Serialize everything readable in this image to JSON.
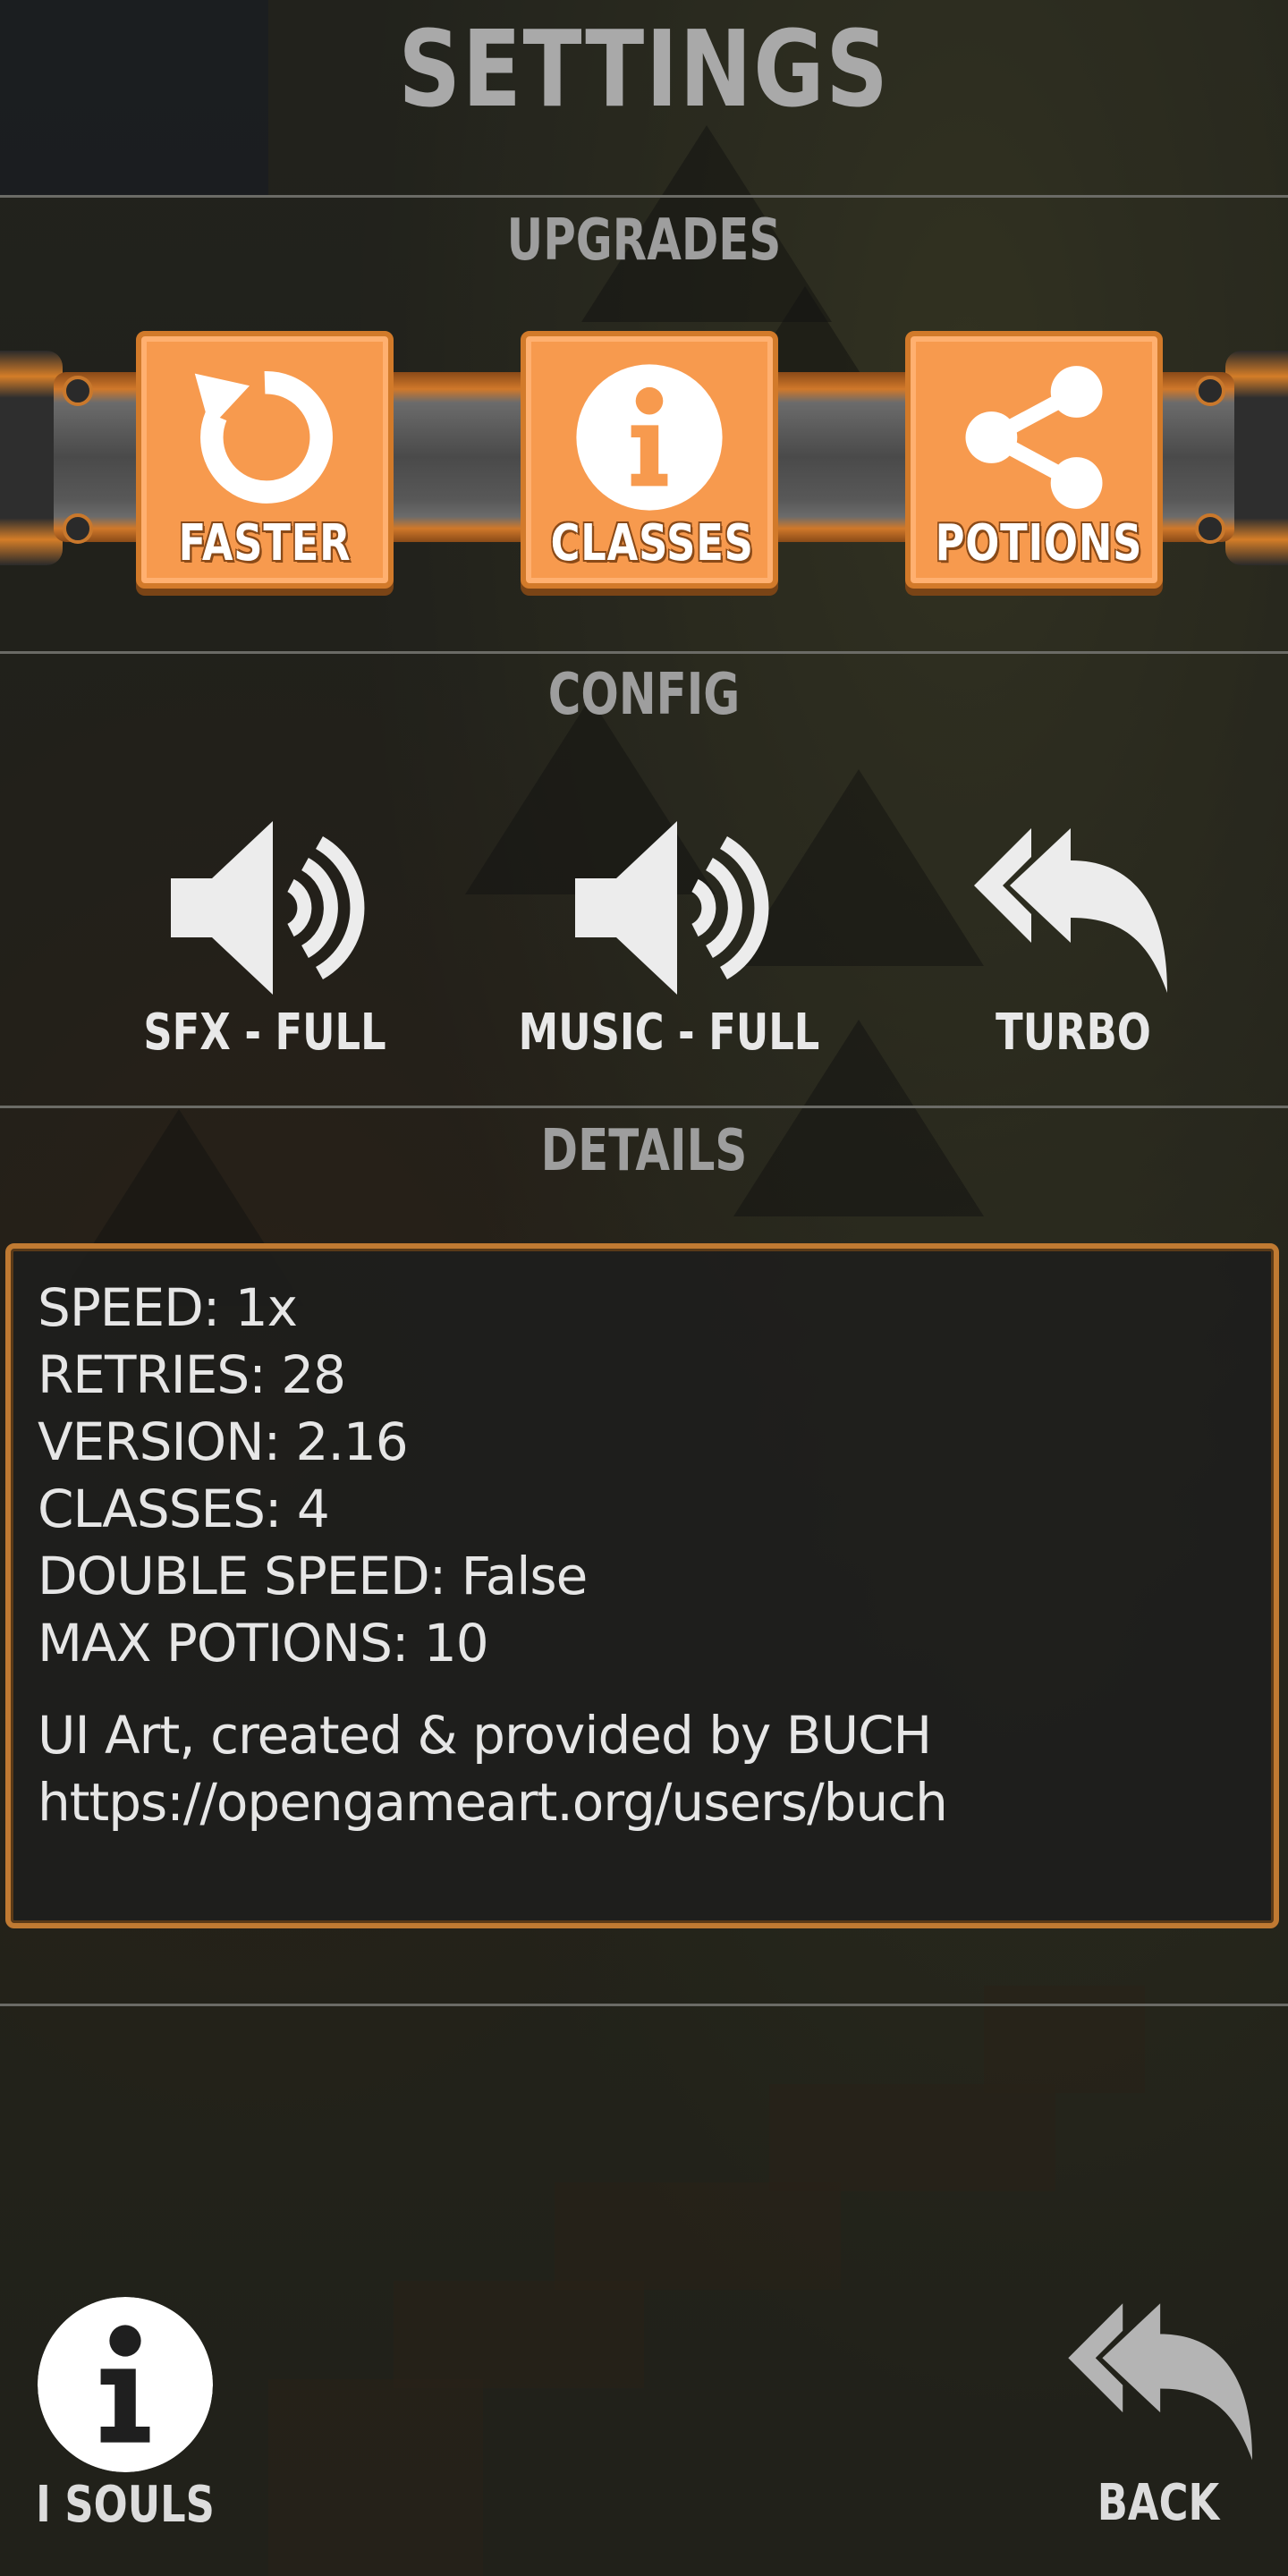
{
  "title": "SETTINGS",
  "upgrades": {
    "heading": "UPGRADES",
    "buttons": [
      {
        "label": "FASTER",
        "icon": "refresh-icon"
      },
      {
        "label": "CLASSES",
        "icon": "info-icon"
      },
      {
        "label": "POTIONS",
        "icon": "share-icon"
      }
    ]
  },
  "config": {
    "heading": "CONFIG",
    "items": [
      {
        "label": "SFX - FULL",
        "icon": "speaker-icon"
      },
      {
        "label": "MUSIC - FULL",
        "icon": "speaker-icon"
      },
      {
        "label": "TURBO",
        "icon": "double-reply-arrow-icon"
      }
    ]
  },
  "details": {
    "heading": "DETAILS",
    "lines": [
      "SPEED: 1x",
      "RETRIES: 28",
      "VERSION: 2.16",
      "CLASSES: 4",
      "DOUBLE SPEED: False",
      "MAX POTIONS: 10"
    ],
    "credit": "UI Art, created & provided by BUCH",
    "credit_url": "https://opengameart.org/users/buch"
  },
  "footer": {
    "souls_label": "I SOULS",
    "back_label": "BACK"
  },
  "colors": {
    "button_orange": "#f79a4e",
    "button_border": "#d27a2a",
    "panel_border": "#c07a32",
    "heading_gray": "#9e9e9e"
  }
}
